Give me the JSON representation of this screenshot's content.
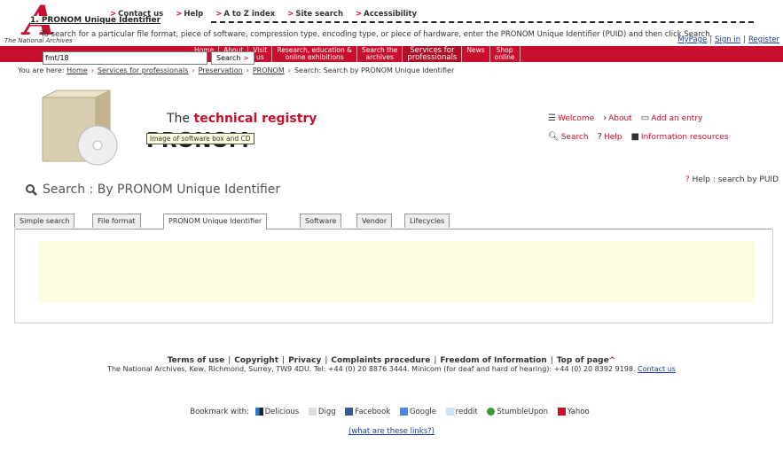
{
  "logo": {
    "letter": "A",
    "name": "The National Archives"
  },
  "top_links": [
    "Contact us",
    "Help",
    "A to Z index",
    "Site search",
    "Accessibility"
  ],
  "user_links": [
    "MyPage",
    "Sign in",
    "Register"
  ],
  "nav": [
    {
      "line1": "Home",
      "line2": ""
    },
    {
      "line1": "About",
      "line2": "us"
    },
    {
      "line1": "Visit",
      "line2": "us"
    },
    {
      "line1": "Research, education &",
      "line2": "online exhibitions"
    },
    {
      "line1": "Search the",
      "line2": "archives"
    },
    {
      "line1": "Services for",
      "line2": "professionals"
    },
    {
      "line1": "News",
      "line2": ""
    },
    {
      "line1": "Shop",
      "line2": "online"
    }
  ],
  "breadcrumb": {
    "prefix": "You are here:",
    "items": [
      "Home",
      "Services for professionals",
      "Preservation",
      "PRONOM"
    ],
    "current": "Search: Search by PRONOM Unique Identifier"
  },
  "banner": {
    "tagline_prefix": "The",
    "tagline_highlight": "technical registry",
    "brand": "PRONOM",
    "image_label": "Image of software box and CD"
  },
  "toolbar": {
    "welcome": "Welcome",
    "about": "About",
    "add_entry": "Add an entry",
    "search": "Search",
    "help": "Help",
    "info": "Information resources"
  },
  "page": {
    "title": "Search : By PRONOM Unique Identifier",
    "help_link": "Help : search by PUID"
  },
  "tabs": [
    "Simple search",
    "File format",
    "PRONOM Unique Identifier",
    "Software",
    "Vendor",
    "Lifecycles"
  ],
  "search_form": {
    "legend": "1. PRONOM Unique Identifier",
    "description": "To search for a particular file format, piece of software, compression type, encoding type, or piece of hardware, enter the PRONOM Unique Identifier (PUID) and then click Search.",
    "input_value": "fmt/18",
    "button_label": "Search"
  },
  "footer": {
    "links": [
      "Terms of use",
      "Copyright",
      "Privacy",
      "Complaints procedure",
      "Freedom of Information",
      "Top of page"
    ],
    "address": "The National Archives, Kew, Richmond, Surrey, TW9 4DU. Tel: +44 (0) 20 8876 3444. Minicom (for deaf and hard of hearing): +44 (0) 20 8392 9198.",
    "contact": "Contact us",
    "bookmarks_label": "Bookmark with:",
    "bookmarks": [
      "Delicious",
      "Digg",
      "Facebook",
      "Google",
      "reddit",
      "StumbleUpon",
      "Yahoo"
    ],
    "what_links": "(what are these links?)"
  },
  "colors": {
    "brand_red": "#c8102e",
    "link_blue": "#1a3a9c"
  }
}
